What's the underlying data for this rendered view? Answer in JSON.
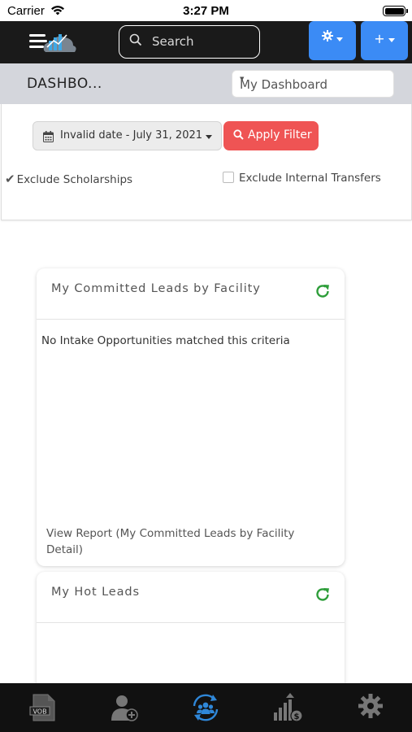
{
  "status_bar": {
    "carrier": "Carrier",
    "time": "3:27 PM"
  },
  "nav": {
    "search_placeholder": "Search",
    "gear_button_icon": "gear-icon",
    "add_button_label": "+"
  },
  "header": {
    "title": "DASHBO...",
    "dashboard_select_value": "My Dashboard"
  },
  "filters": {
    "date_range_label": "Invalid date - July 31, 2021",
    "apply_label": "Apply Filter",
    "exclude_scholarships_label": "Exclude Scholarships",
    "exclude_scholarships_checked": true,
    "exclude_internal_transfers_label": "Exclude Internal Transfers",
    "exclude_internal_transfers_checked": false
  },
  "cards": [
    {
      "title": "My Committed Leads by Facility",
      "empty_message": "No Intake Opportunities matched this criteria",
      "report_link": "View Report (My Committed Leads by Facility Detail)"
    },
    {
      "title": "My Hot Leads"
    }
  ],
  "tabs": [
    {
      "icon": "vob-document-icon",
      "label": "VOB"
    },
    {
      "icon": "add-user-icon"
    },
    {
      "icon": "team-sync-icon",
      "active": true
    },
    {
      "icon": "financial-chart-icon"
    },
    {
      "icon": "settings-gear-icon"
    }
  ],
  "colors": {
    "primary_blue": "#3b8bf5",
    "danger_red": "#ef5454",
    "refresh_green": "#2e9e3a",
    "active_tab_blue": "#2f87d8",
    "nav_dark": "#1a1a1a"
  }
}
